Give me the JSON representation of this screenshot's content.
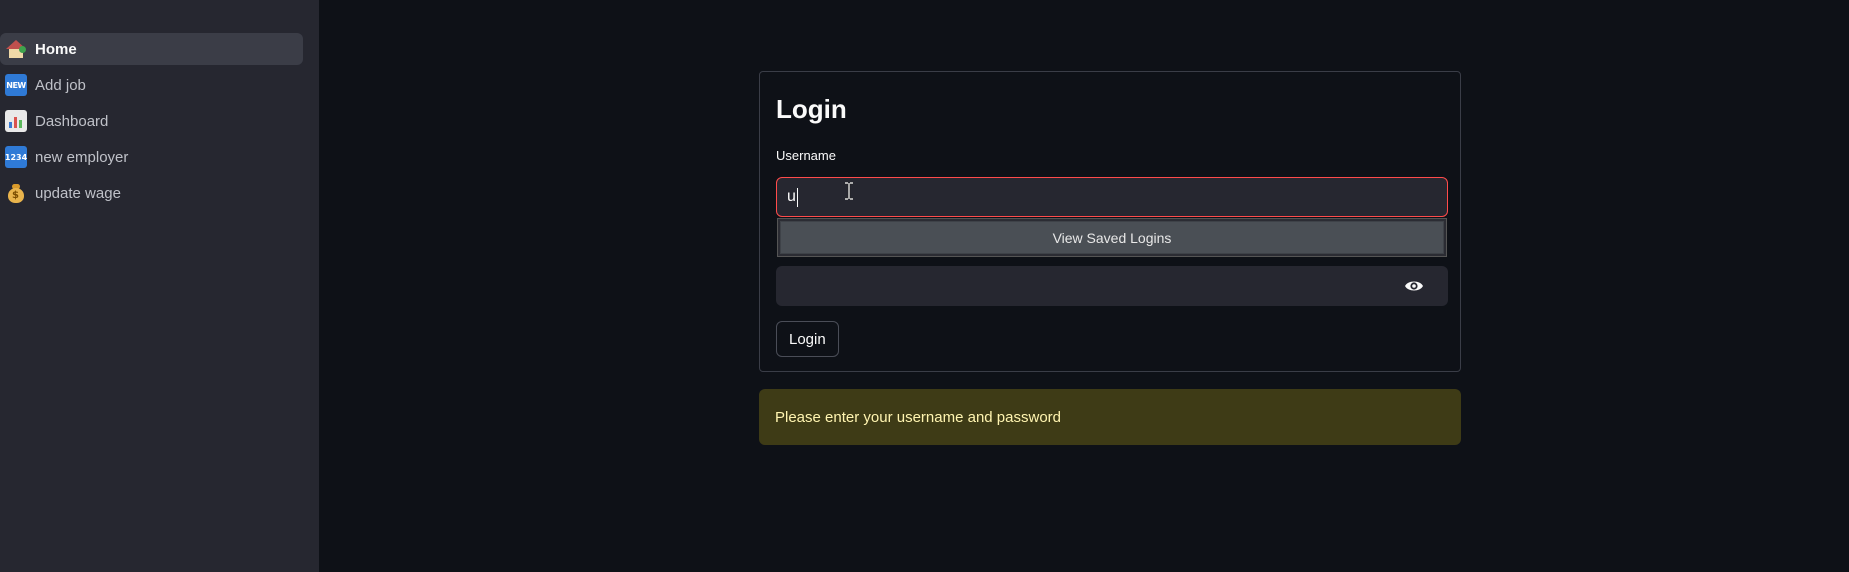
{
  "sidebar": {
    "items": [
      {
        "label": "Home",
        "icon": "house-with-garden-icon",
        "active": true
      },
      {
        "label": "Add job",
        "icon": "new-button-icon",
        "active": false
      },
      {
        "label": "Dashboard",
        "icon": "bar-chart-icon",
        "active": false
      },
      {
        "label": "new employer",
        "icon": "input-numbers-icon",
        "active": false
      },
      {
        "label": "update wage",
        "icon": "money-bag-icon",
        "active": false
      }
    ],
    "new_icon_text": "NEW",
    "numbers_icon_text": "1234",
    "money_icon_text": "$"
  },
  "login_form": {
    "title": "Login",
    "username_label": "Username",
    "username_value": "u",
    "autofill_label": "View Saved Logins",
    "password_value": "",
    "submit_label": "Login"
  },
  "alert": {
    "message": "Please enter your username and password"
  },
  "colors": {
    "background": "#0e1117",
    "sidebar": "#262730",
    "error_border": "#ff4b4b",
    "warning_bg": "#3e3b16",
    "warning_text": "#fff4b0"
  }
}
